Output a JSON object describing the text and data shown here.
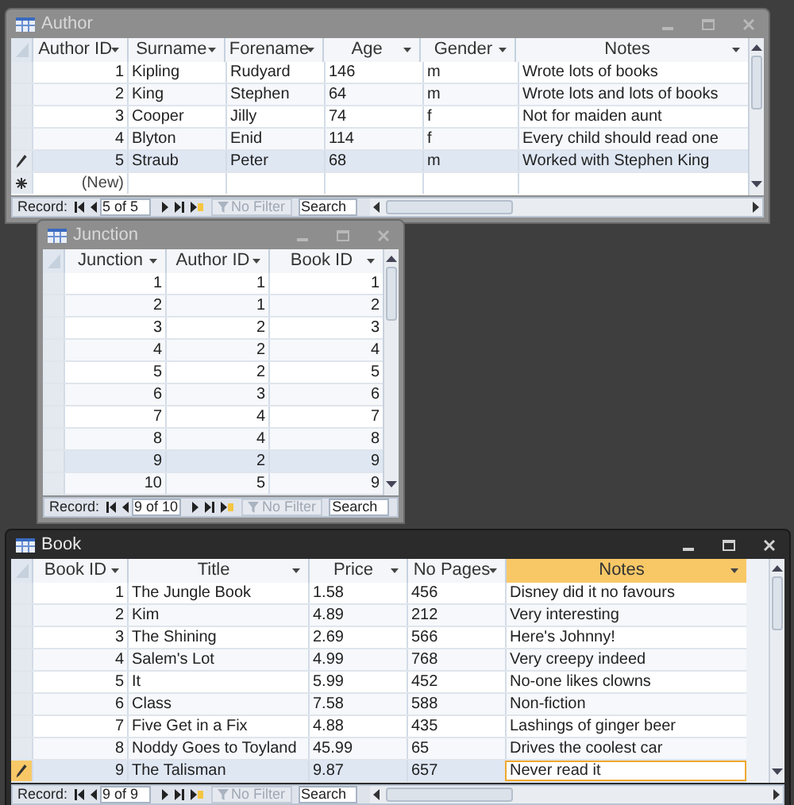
{
  "windows": [
    {
      "title": "Author",
      "active": false,
      "columns": [
        {
          "label": "Author ID",
          "kind": "number",
          "active": false
        },
        {
          "label": "Surname",
          "kind": "text",
          "active": false
        },
        {
          "label": "Forename",
          "kind": "text",
          "active": false
        },
        {
          "label": "Age",
          "kind": "text",
          "active": false
        },
        {
          "label": "Gender",
          "kind": "text",
          "active": false
        },
        {
          "label": "Notes",
          "kind": "text",
          "active": false
        }
      ],
      "rows": [
        {
          "cells": [
            "1",
            "Kipling",
            "Rudyard",
            "146",
            "m",
            "Wrote lots of books"
          ],
          "selected": false,
          "editing": false
        },
        {
          "cells": [
            "2",
            "King",
            "Stephen",
            "64",
            "m",
            "Wrote lots and lots of books"
          ],
          "selected": false,
          "editing": false
        },
        {
          "cells": [
            "3",
            "Cooper",
            "Jilly",
            "74",
            "f",
            "Not for maiden aunt"
          ],
          "selected": false,
          "editing": false
        },
        {
          "cells": [
            "4",
            "Blyton",
            "Enid",
            "114",
            "f",
            "Every child should read one"
          ],
          "selected": false,
          "editing": false
        },
        {
          "cells": [
            "5",
            "Straub",
            "Peter",
            "68",
            "m",
            "Worked with Stephen King"
          ],
          "selected": true,
          "editing": true
        }
      ],
      "new_row": "(New)",
      "nav": {
        "label": "Record:",
        "position": "5 of 5",
        "filter": "No Filter",
        "search": "Search"
      }
    },
    {
      "title": "Junction",
      "active": false,
      "columns": [
        {
          "label": "Junction",
          "kind": "number",
          "active": false
        },
        {
          "label": "Author ID",
          "kind": "number",
          "active": false
        },
        {
          "label": "Book ID",
          "kind": "number",
          "active": false
        }
      ],
      "rows": [
        {
          "cells": [
            "1",
            "1",
            "1"
          ],
          "selected": false,
          "editing": false
        },
        {
          "cells": [
            "2",
            "1",
            "2"
          ],
          "selected": false,
          "editing": false
        },
        {
          "cells": [
            "3",
            "2",
            "3"
          ],
          "selected": false,
          "editing": false
        },
        {
          "cells": [
            "4",
            "2",
            "4"
          ],
          "selected": false,
          "editing": false
        },
        {
          "cells": [
            "5",
            "2",
            "5"
          ],
          "selected": false,
          "editing": false
        },
        {
          "cells": [
            "6",
            "3",
            "6"
          ],
          "selected": false,
          "editing": false
        },
        {
          "cells": [
            "7",
            "4",
            "7"
          ],
          "selected": false,
          "editing": false
        },
        {
          "cells": [
            "8",
            "4",
            "8"
          ],
          "selected": false,
          "editing": false
        },
        {
          "cells": [
            "9",
            "2",
            "9"
          ],
          "selected": true,
          "editing": false
        },
        {
          "cells": [
            "10",
            "5",
            "9"
          ],
          "selected": false,
          "editing": false
        }
      ],
      "nav": {
        "label": "Record:",
        "position": "9 of 10",
        "filter": "No Filter",
        "search": "Search"
      }
    },
    {
      "title": "Book",
      "active": true,
      "columns": [
        {
          "label": "Book ID",
          "kind": "number",
          "active": false
        },
        {
          "label": "Title",
          "kind": "text",
          "active": false
        },
        {
          "label": "Price",
          "kind": "text",
          "active": false
        },
        {
          "label": "No Pages",
          "kind": "text",
          "active": false
        },
        {
          "label": "Notes",
          "kind": "text",
          "active": true
        }
      ],
      "rows": [
        {
          "cells": [
            "1",
            "The Jungle Book",
            "1.58",
            "456",
            "Disney did it no favours"
          ],
          "selected": false,
          "editing": false
        },
        {
          "cells": [
            "2",
            "Kim",
            "4.89",
            "212",
            "Very interesting"
          ],
          "selected": false,
          "editing": false
        },
        {
          "cells": [
            "3",
            "The Shining",
            "2.69",
            "566",
            "Here's Johnny!"
          ],
          "selected": false,
          "editing": false
        },
        {
          "cells": [
            "4",
            "Salem's Lot",
            "4.99",
            "768",
            "Very creepy indeed"
          ],
          "selected": false,
          "editing": false
        },
        {
          "cells": [
            "5",
            "It",
            "5.99",
            "452",
            "No-one likes clowns"
          ],
          "selected": false,
          "editing": false
        },
        {
          "cells": [
            "6",
            "Class",
            "7.58",
            "588",
            "Non-fiction"
          ],
          "selected": false,
          "editing": false
        },
        {
          "cells": [
            "7",
            "Five Get in a Fix",
            "4.88",
            "435",
            "Lashings of ginger beer"
          ],
          "selected": false,
          "editing": false
        },
        {
          "cells": [
            "8",
            "Noddy Goes to Toyland",
            "45.99",
            "65",
            "Drives the coolest car"
          ],
          "selected": false,
          "editing": false
        },
        {
          "cells": [
            "9",
            "The Talisman",
            "9.87",
            "657",
            "Never read it"
          ],
          "selected": true,
          "editing": true
        }
      ],
      "nav": {
        "label": "Record:",
        "position": "9 of 9",
        "filter": "No Filter",
        "search": "Search"
      }
    }
  ]
}
